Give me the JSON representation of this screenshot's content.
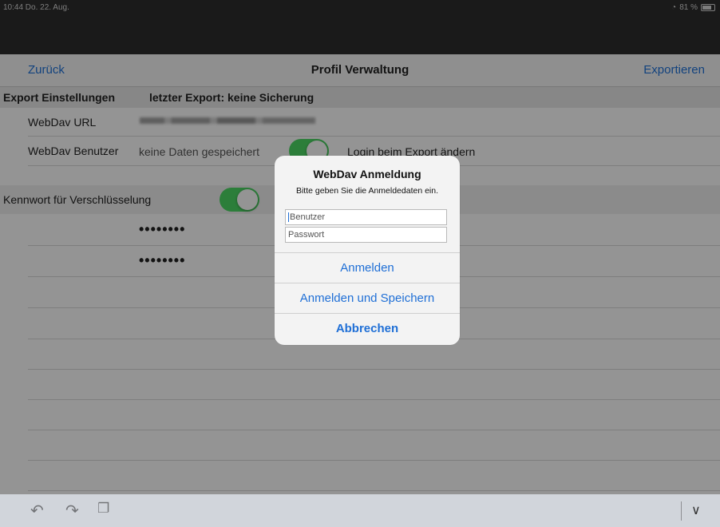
{
  "status": {
    "time": "10:44  Do. 22. Aug.",
    "battery": "81 %"
  },
  "nav": {
    "back": "Zurück",
    "title": "Profil Verwaltung",
    "export": "Exportieren"
  },
  "section1": {
    "title": "Export Einstellungen",
    "last_export": "letzter Export: keine Sicherung"
  },
  "rows": {
    "webdav_url_label": "WebDav URL",
    "webdav_user_label": "WebDav Benutzer",
    "webdav_user_value": "keine Daten gespeichert",
    "login_change_label": "Login beim Export ändern",
    "password_enc_label": "Kennwort für Verschlüsselung",
    "password1": "••••••••",
    "password2": "••••••••"
  },
  "alert": {
    "title": "WebDav Anmeldung",
    "message": "Bitte geben Sie die Anmeldedaten ein.",
    "user_placeholder": "Benutzer",
    "password_placeholder": "Passwort",
    "login": "Anmelden",
    "login_save": "Anmelden und Speichern",
    "cancel": "Abbrechen"
  },
  "colors": {
    "accent": "#1f72d9",
    "toggle_on": "#4cd964"
  },
  "icons": {
    "undo": "undo-icon",
    "redo": "redo-icon",
    "paste": "paste-icon",
    "chevron": "chevron-down-icon",
    "wifi": "wifi-icon"
  }
}
